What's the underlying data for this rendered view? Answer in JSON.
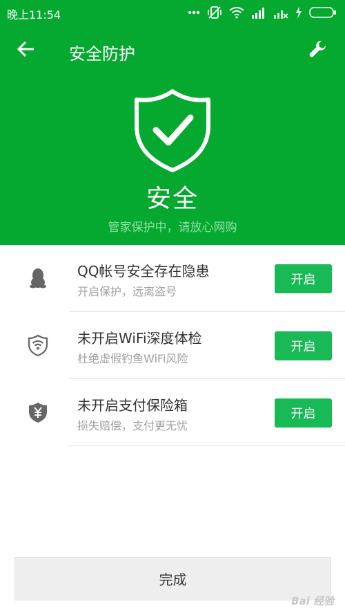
{
  "status_bar": {
    "time": "晚上11:54",
    "icons": [
      "more-dots-icon",
      "vibrate-off-icon",
      "wifi-icon",
      "signal-icon",
      "signal-x-icon",
      "charging-icon",
      "battery-icon"
    ]
  },
  "titlebar": {
    "title": "安全防护",
    "back_icon": "arrow-left-icon",
    "settings_icon": "wrench-icon"
  },
  "hero": {
    "status": "安全",
    "subtitle": "管家保护中，请放心网购",
    "icon": "shield-check-icon"
  },
  "items": [
    {
      "icon": "qq-penguin-icon",
      "title": "QQ帐号安全存在隐患",
      "desc": "开启保护，远离盗号",
      "button": "开启"
    },
    {
      "icon": "wifi-shield-icon",
      "title": "未开启WiFi深度体检",
      "desc": "杜绝虚假钓鱼WiFi风险",
      "button": "开启"
    },
    {
      "icon": "yen-shield-icon",
      "title": "未开启支付保险箱",
      "desc": "损失赔偿，支付更无忧",
      "button": "开启"
    }
  ],
  "done_button": "完成",
  "watermark": "Bai 经验",
  "colors": {
    "header_bg": "#06a930",
    "button_bg": "#19b955",
    "subtitle": "#8fe0a4"
  }
}
